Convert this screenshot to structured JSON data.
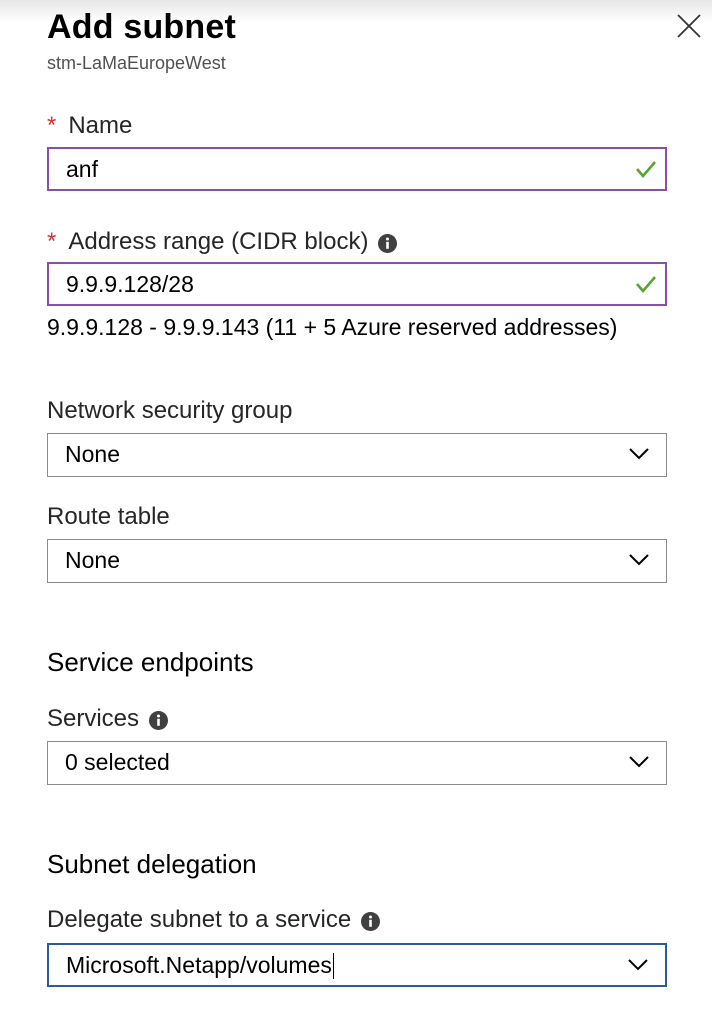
{
  "panel": {
    "title": "Add subnet",
    "subtitle": "stm-LaMaEuropeWest",
    "close_icon": "close-icon"
  },
  "fields": {
    "name": {
      "required_marker": "*",
      "label": "Name",
      "value": "anf",
      "status_icon": "checkmark-icon",
      "status_color": "#5ba330"
    },
    "address_range": {
      "required_marker": "*",
      "label": "Address range (CIDR block)",
      "info_icon": "info-icon",
      "value": "9.9.9.128/28",
      "status_icon": "checkmark-icon",
      "range_note": "9.9.9.128 - 9.9.9.143 (11 + 5 Azure reserved addresses)"
    },
    "network_security_group": {
      "label": "Network security group",
      "selected": "None"
    },
    "route_table": {
      "label": "Route table",
      "selected": "None"
    }
  },
  "service_endpoints": {
    "heading": "Service endpoints",
    "services_label": "Services",
    "info_icon": "info-icon",
    "selected": "0 selected"
  },
  "subnet_delegation": {
    "heading": "Subnet delegation",
    "delegate_label": "Delegate subnet to a service",
    "info_icon": "info-icon",
    "selected": "Microsoft.Netapp/volumes"
  },
  "colors": {
    "required": "#d13438",
    "valid_border": "#8b4ea8",
    "focused_border": "#2d5a9c",
    "check": "#5ba330"
  }
}
